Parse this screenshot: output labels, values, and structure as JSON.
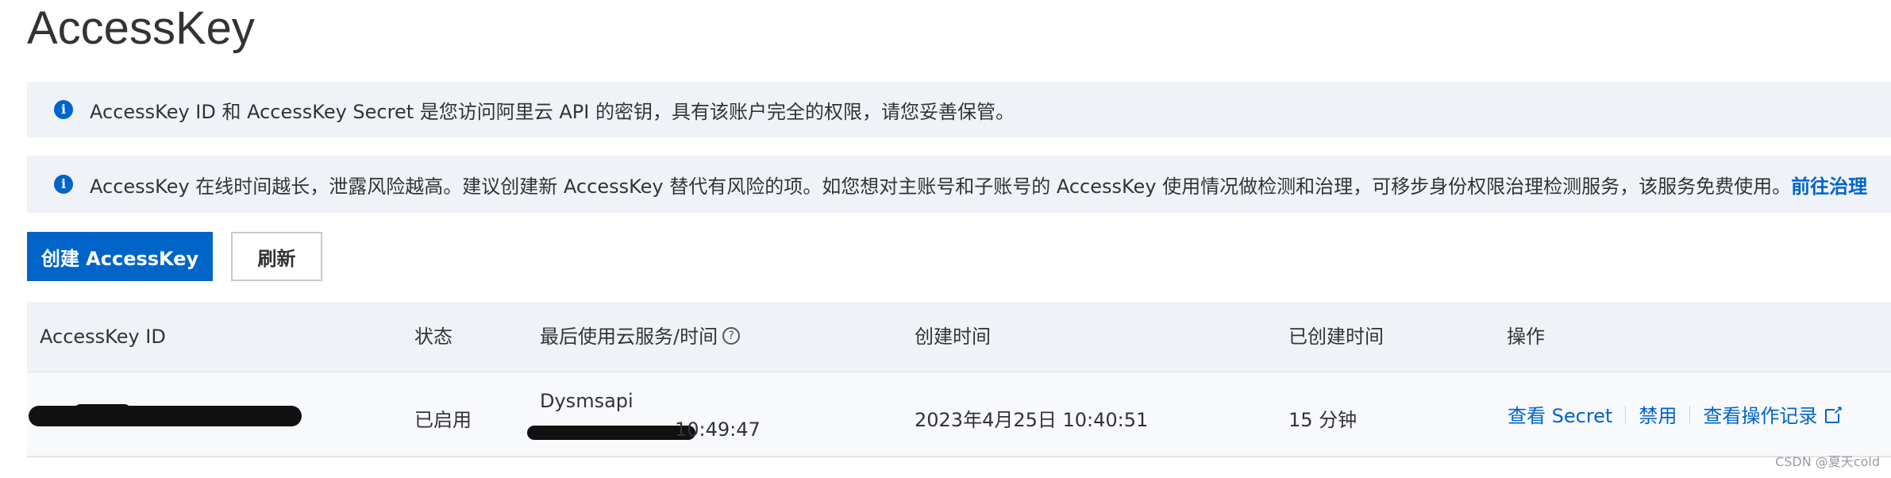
{
  "page": {
    "title": "AccessKey"
  },
  "alerts": [
    {
      "text": "AccessKey ID 和 AccessKey Secret 是您访问阿里云 API 的密钥，具有该账户完全的权限，请您妥善保管。"
    },
    {
      "text": "AccessKey 在线时间越长，泄露风险越高。建议创建新 AccessKey 替代有风险的项。如您想对主账号和子账号的 AccessKey 使用情况做检测和治理，可移步身份权限治理检测服务，该服务免费使用。",
      "link": "前往治理"
    }
  ],
  "toolbar": {
    "create_label": "创建 AccessKey",
    "refresh_label": "刷新"
  },
  "table": {
    "headers": {
      "id": "AccessKey ID",
      "status": "状态",
      "last_used": "最后使用云服务/时间",
      "created": "创建时间",
      "age": "已创建时间",
      "actions": "操作"
    },
    "rows": [
      {
        "status": "已启用",
        "last_service": "Dysmsapi",
        "last_time": "10:49:47",
        "created": "2023年4月25日 10:40:51",
        "age": "15 分钟",
        "actions": {
          "view_secret": "查看 Secret",
          "disable": "禁用",
          "logs": "查看操作记录"
        }
      }
    ]
  },
  "watermark": "CSDN @夏天cold",
  "icons": {
    "info": "info-icon",
    "help": "question-circle-icon",
    "external": "external-link-icon"
  },
  "colors": {
    "primary": "#0064c8",
    "alert_bg": "#eff3f8"
  }
}
